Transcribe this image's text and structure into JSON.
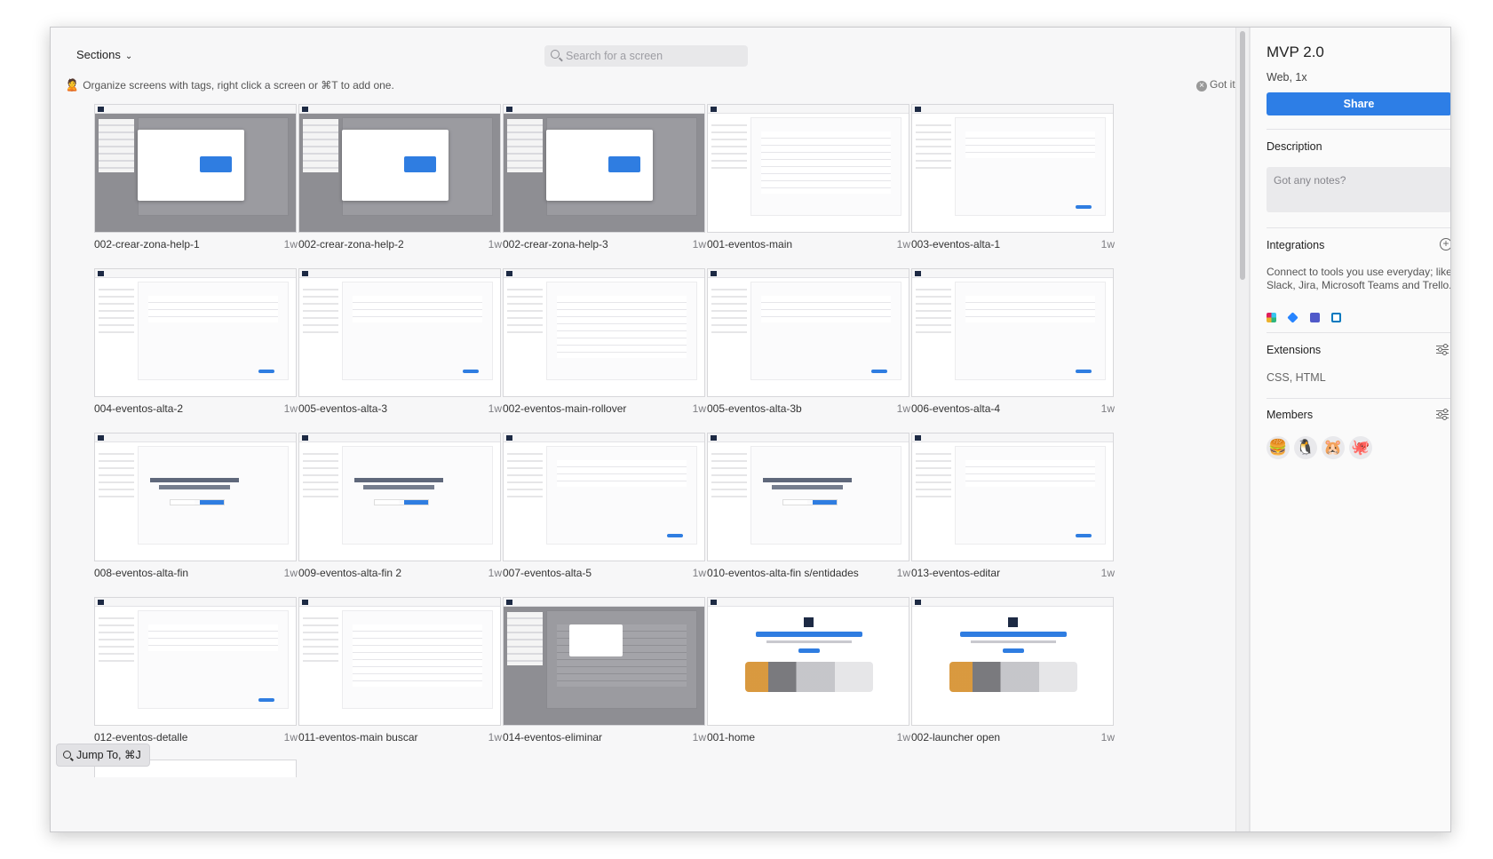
{
  "toolbar": {
    "sections_label": "Sections",
    "search_placeholder": "Search for a screen"
  },
  "tip": {
    "emoji": "🙎",
    "text": "Organize screens with tags, right click a screen or ⌘T to add one.",
    "dismiss_label": "Got it"
  },
  "screens": [
    {
      "name": "002-crear-zona-help-1",
      "age": "1w"
    },
    {
      "name": "002-crear-zona-help-2",
      "age": "1w"
    },
    {
      "name": "002-crear-zona-help-3",
      "age": "1w"
    },
    {
      "name": "001-eventos-main",
      "age": "1w"
    },
    {
      "name": "003-eventos-alta-1",
      "age": "1w"
    },
    {
      "name": "004-eventos-alta-2",
      "age": "1w"
    },
    {
      "name": "005-eventos-alta-3",
      "age": "1w"
    },
    {
      "name": "002-eventos-main-rollover",
      "age": "1w"
    },
    {
      "name": "005-eventos-alta-3b",
      "age": "1w"
    },
    {
      "name": "006-eventos-alta-4",
      "age": "1w"
    },
    {
      "name": "008-eventos-alta-fin",
      "age": "1w"
    },
    {
      "name": "009-eventos-alta-fin 2",
      "age": "1w"
    },
    {
      "name": "007-eventos-alta-5",
      "age": "1w"
    },
    {
      "name": "010-eventos-alta-fin s/entidades",
      "age": "1w"
    },
    {
      "name": "013-eventos-editar",
      "age": "1w"
    },
    {
      "name": "012-eventos-detalle",
      "age": "1w"
    },
    {
      "name": "011-eventos-main buscar",
      "age": "1w"
    },
    {
      "name": "014-eventos-eliminar",
      "age": "1w"
    },
    {
      "name": "001-home",
      "age": "1w"
    },
    {
      "name": "002-launcher open",
      "age": "1w"
    }
  ],
  "jump": {
    "label": "Jump To, ⌘J"
  },
  "sidebar": {
    "project_title": "MVP 2.0",
    "platform": "Web, 1x",
    "share_label": "Share",
    "description_heading": "Description",
    "notes_placeholder": "Got any notes?",
    "integrations_heading": "Integrations",
    "integrations_text": "Connect to tools you use everyday; like Slack, Jira, Microsoft Teams and Trello.",
    "integration_icons": [
      "slack-icon",
      "jira-icon",
      "teams-icon",
      "trello-icon"
    ],
    "extensions_heading": "Extensions",
    "extensions_value": "CSS, HTML",
    "members_heading": "Members",
    "members": [
      "🍔",
      "🐧",
      "🐹",
      "🐙"
    ]
  },
  "colors": {
    "accent": "#2d7ee6",
    "background": "#f7f7f8",
    "sidebar_background": "#fafafa"
  }
}
